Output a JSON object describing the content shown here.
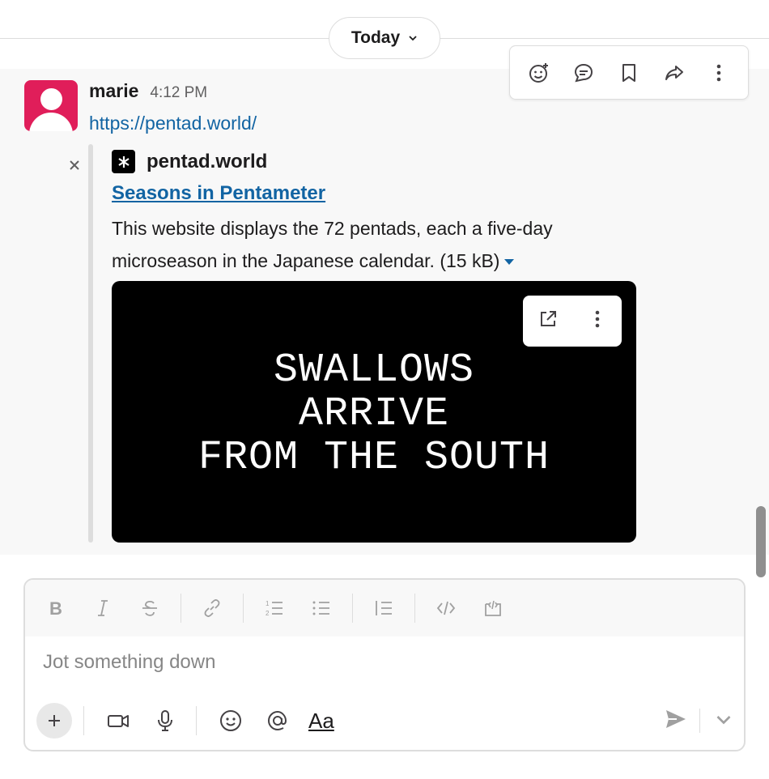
{
  "date_divider": {
    "label": "Today"
  },
  "message_actions": {
    "icons": [
      "add-reaction-icon",
      "reply-in-thread-icon",
      "save-for-later-icon",
      "share-icon",
      "more-actions-icon"
    ]
  },
  "message": {
    "author": "marie",
    "time": "4:12 PM",
    "text_link": "https://pentad.world/"
  },
  "unfurl": {
    "site_name": "pentad.world",
    "title": "Seasons in Pentameter",
    "description": "This website displays the 72 pentads, each a five-day microseason in the Japanese calendar.",
    "size": "(15 kB)",
    "preview_lines": [
      "SWALLOWS",
      "ARRIVE",
      "FROM THE SOUTH"
    ]
  },
  "composer": {
    "placeholder": "Jot something down",
    "format_button_label": "Aa",
    "formatting_tools": [
      "bold",
      "italic",
      "strikethrough",
      "link",
      "ordered-list",
      "bulleted-list",
      "blockquote",
      "code",
      "code-block"
    ]
  },
  "colors": {
    "link": "#1264a3",
    "avatar": "#e01e5a",
    "preview_bg": "#000000"
  }
}
